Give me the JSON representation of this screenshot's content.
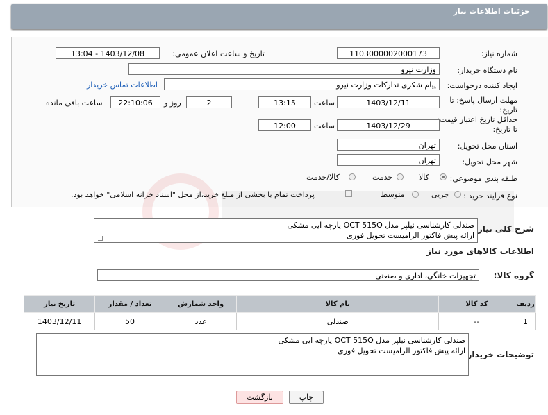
{
  "header": {
    "title": "جزئیات اطلاعات نیاز"
  },
  "form": {
    "need_number_label": "شماره نیاز:",
    "need_number": "1103000002000173",
    "announce_label": "تاریخ و ساعت اعلان عمومی:",
    "announce_value": "1403/12/08 - 13:04",
    "buyer_org_label": "نام دستگاه خریدار:",
    "buyer_org": "وزارت نيرو",
    "creator_label": "ایجاد کننده درخواست:",
    "creator": "پیام شکری تدارکات وزارت نیرو",
    "contact_link": "اطلاعات تماس خریدار",
    "deadline_label": "مهلت ارسال پاسخ: تا تاریخ:",
    "deadline_date": "1403/12/11",
    "time_label": "ساعت",
    "deadline_time": "13:15",
    "days_value": "2",
    "days_label": "روز و",
    "remaining_time": "22:10:06",
    "remaining_label": "ساعت باقی مانده",
    "validity_label": "حداقل تاریخ اعتبار قیمت: تا تاریخ:",
    "validity_date": "1403/12/29",
    "validity_time": "12:00",
    "province_label": "استان محل تحویل:",
    "province": "تهران",
    "city_label": "شهر محل تحویل:",
    "city": "تهران",
    "category_label": "طبقه بندی موضوعی:",
    "category_options": [
      "کالا",
      "خدمت",
      "کالا/خدمت"
    ],
    "process_label": "نوع فرآیند خرید :",
    "process_options": [
      "جزیی",
      "متوسط"
    ],
    "payment_note": "پرداخت تمام یا بخشی از مبلغ خرید،از محل \"اسناد خزانه اسلامی\" خواهد بود."
  },
  "summary": {
    "label": "شرح کلی نیاز:",
    "line1": "صندلی کارشناسی نیلپر مدل OCT 515O پارچه ایی مشکی",
    "line2": "ارائه پیش فاکتور الزامیست تحویل فوری"
  },
  "goods_section": {
    "title": "اطلاعات کالاهای مورد نیاز",
    "group_label": "گروه کالا:",
    "group_value": "تجهیزات خانگی، اداری و صنعتی"
  },
  "table": {
    "headers": [
      "ردیف",
      "کد کالا",
      "نام کالا",
      "واحد شمارش",
      "تعداد / مقدار",
      "تاریخ نیاز"
    ],
    "rows": [
      [
        "1",
        "--",
        "صندلی",
        "عدد",
        "50",
        "1403/12/11"
      ]
    ]
  },
  "buyer_notes": {
    "label": "توضیحات خریدار:",
    "line1": "صندلی کارشناسی نیلپر مدل OCT 515O پارچه ایی مشکی",
    "line2": "ارائه پیش فاکتور الزامیست تحویل فوری"
  },
  "buttons": {
    "print": "چاپ",
    "back": "بازگشت"
  }
}
